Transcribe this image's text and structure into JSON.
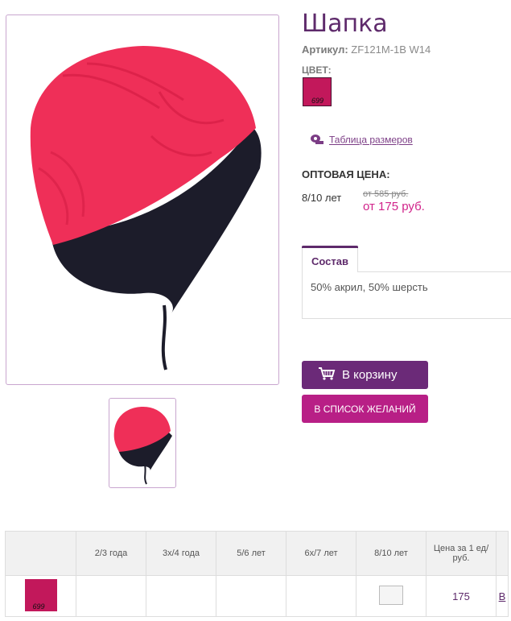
{
  "product": {
    "title": "Шапка",
    "article_label": "Артикул:",
    "article_value": "ZF121M-1B W14",
    "color_label": "ЦВЕТ:",
    "color_code": "699",
    "color_hex": "#c2185b",
    "size_table_link": "Таблица размеров"
  },
  "pricing": {
    "wholesale_label": "ОПТОВАЯ ЦЕНА:",
    "age": "8/10 лет",
    "old_price": "от 585 руб.",
    "new_price": "от 175 руб."
  },
  "tabs": [
    {
      "label": "Состав",
      "content": "50% акрил, 50% шерсть"
    }
  ],
  "actions": {
    "cart_label": "В корзину",
    "wishlist_label": "В СПИСОК ЖЕЛАНИЙ"
  },
  "size_grid": {
    "headers": [
      "",
      "2/3 года",
      "3х/4 года",
      "5/6 лет",
      "6х/7 лет",
      "8/10 лет",
      "Цена за 1 ед/ руб.",
      ""
    ],
    "row": {
      "swatch_code": "699",
      "price": "175",
      "edge_link": "В"
    }
  },
  "colors": {
    "accent": "#5e2a6b",
    "pink": "#d1238a",
    "hat_red": "#ef2f58",
    "hat_band": "#1c1c2a"
  }
}
